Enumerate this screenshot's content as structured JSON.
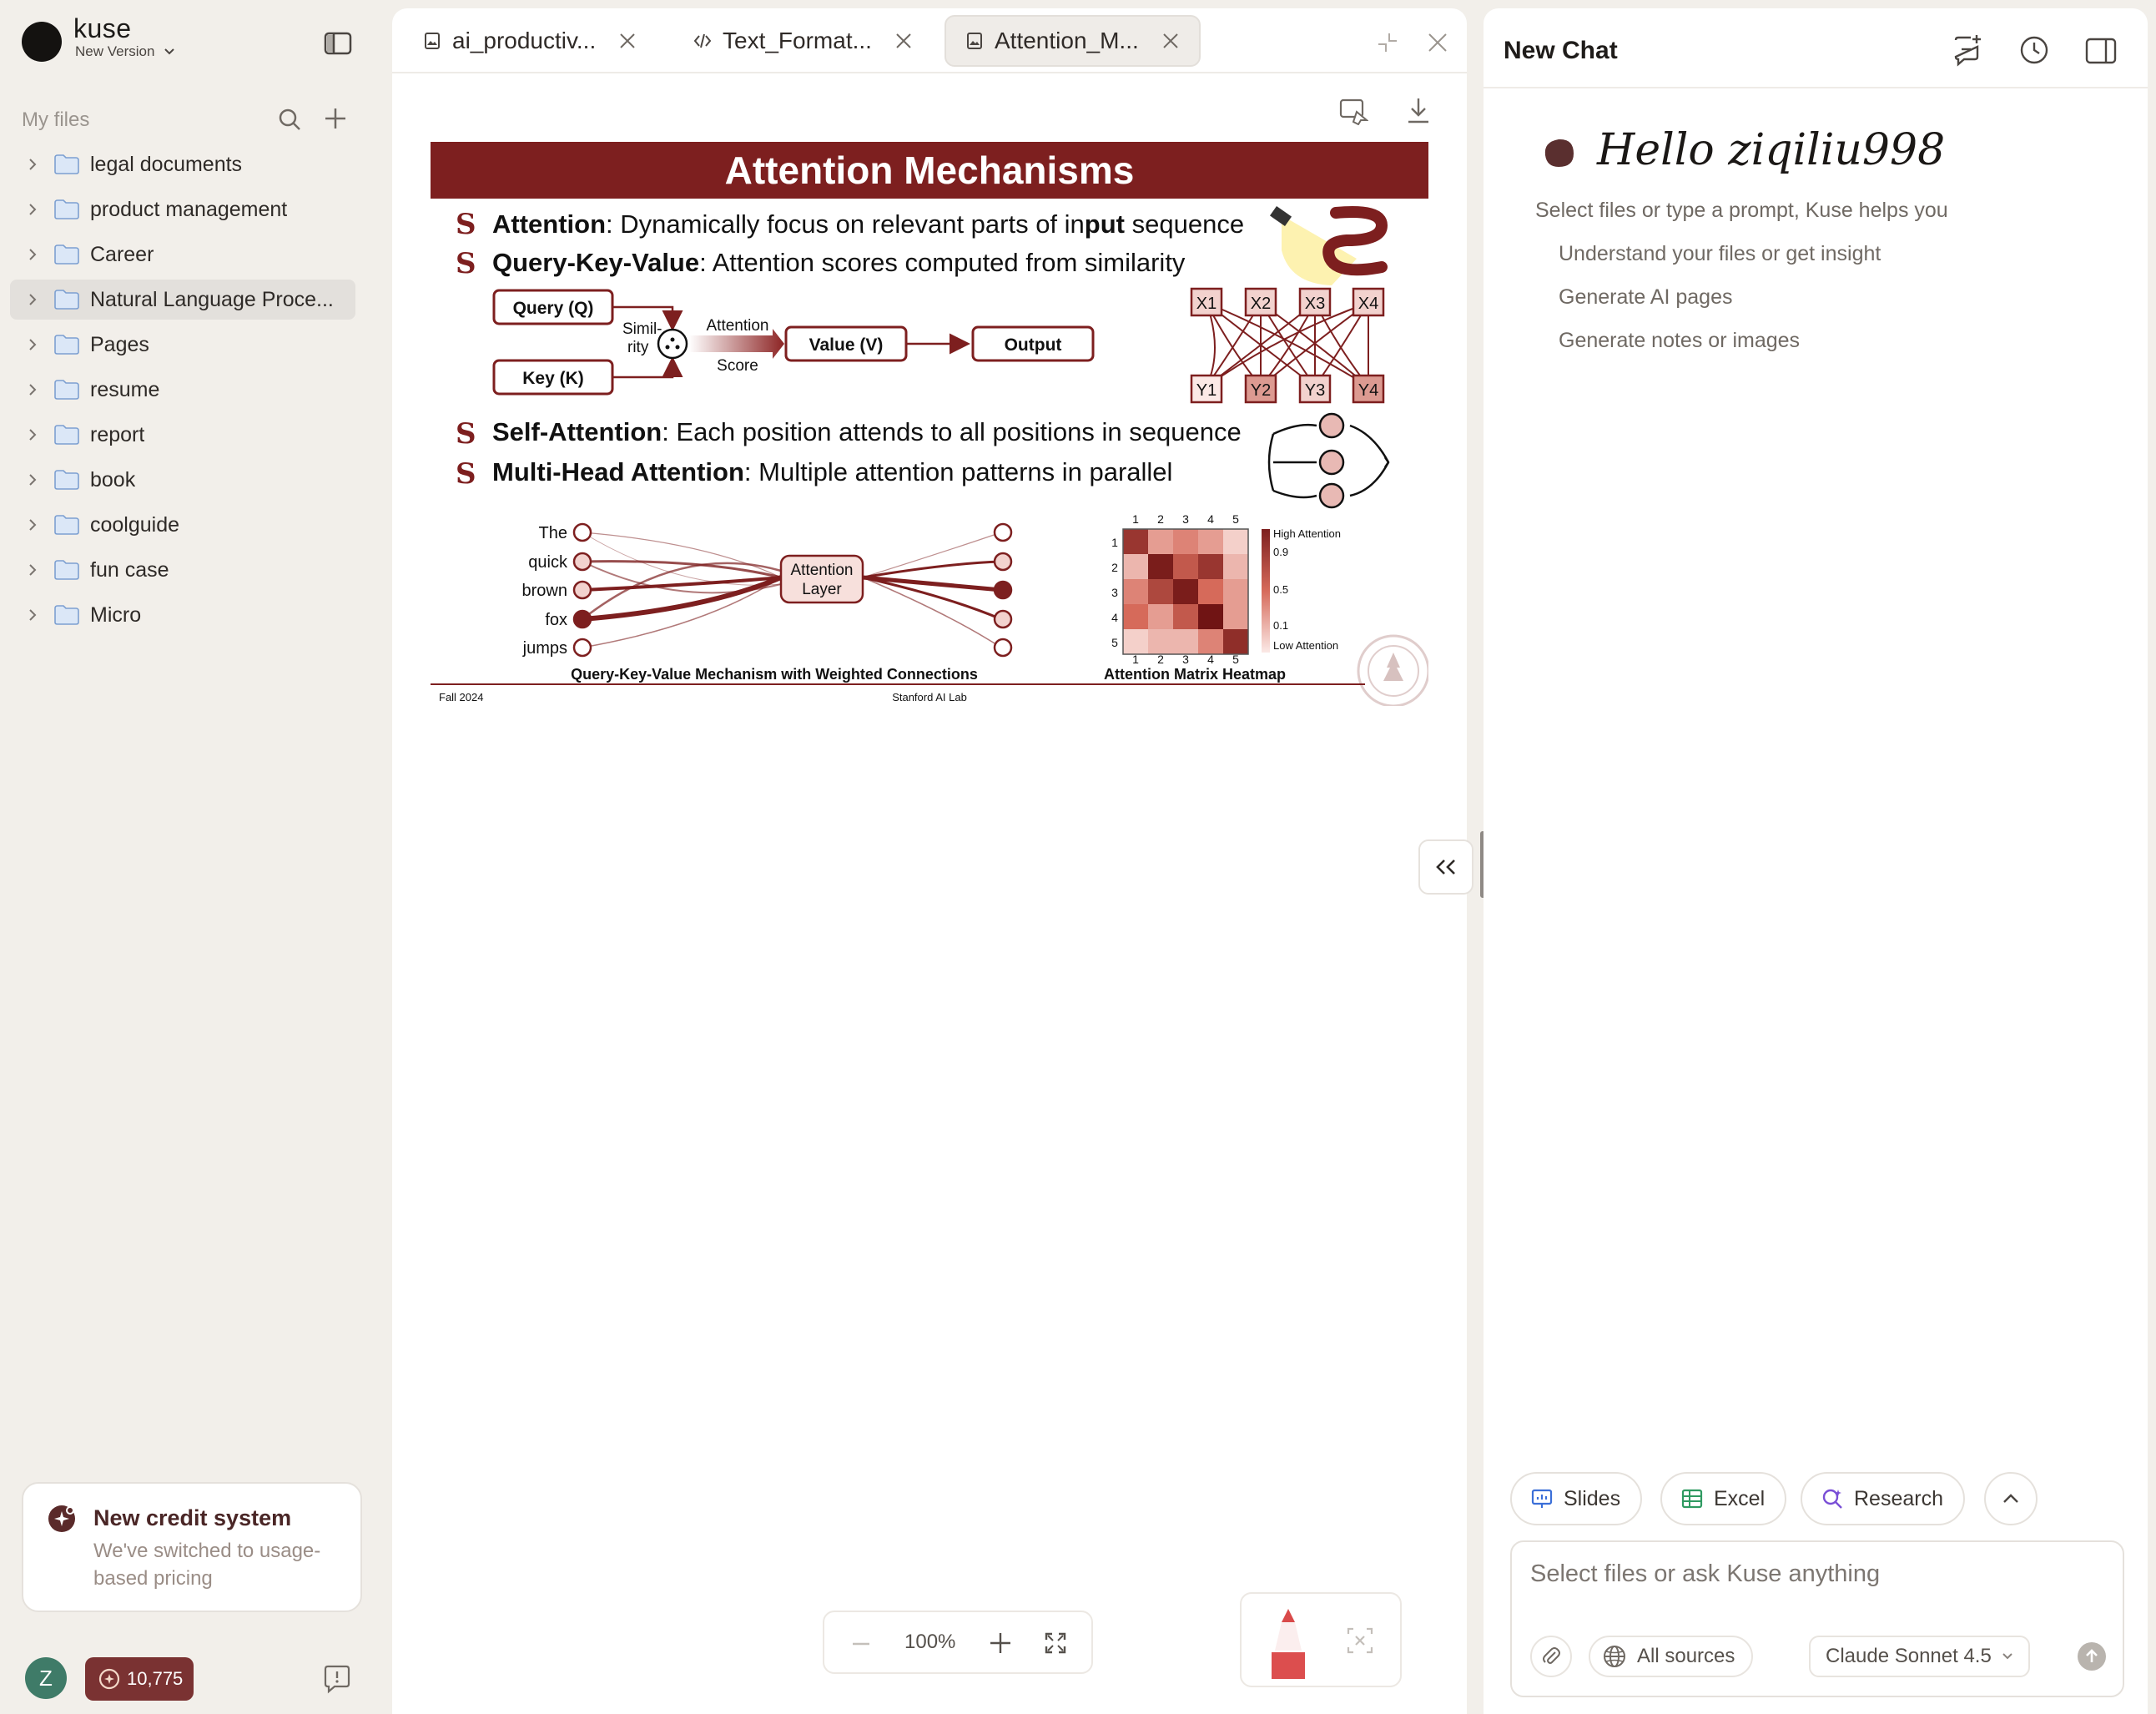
{
  "sidebar": {
    "brand": "kuse",
    "version_label": "New Version",
    "section_title": "My files",
    "folders": [
      {
        "name": "legal documents"
      },
      {
        "name": "product management"
      },
      {
        "name": "Career"
      },
      {
        "name": "Natural Language Proce...",
        "active": true
      },
      {
        "name": "Pages"
      },
      {
        "name": "resume"
      },
      {
        "name": "report"
      },
      {
        "name": "book"
      },
      {
        "name": "coolguide"
      },
      {
        "name": "fun case"
      },
      {
        "name": "Micro"
      }
    ],
    "credit_card": {
      "title": "New credit system",
      "subtitle": "We've switched to usage-based pricing"
    },
    "avatar_letter": "Z",
    "credits": "10,775"
  },
  "tabs": [
    {
      "name": "ai_productiv...",
      "icon": "image-file-icon"
    },
    {
      "name": "Text_Format...",
      "icon": "code-file-icon"
    },
    {
      "name": "Attention_M...",
      "icon": "image-file-icon",
      "active": true
    }
  ],
  "slide": {
    "title": "Attention Mechanisms",
    "bullets": [
      {
        "bold": "Attention",
        "text": ": Dynamically focus on relevant parts of in",
        "bold2": "put",
        "text2": " sequence"
      },
      {
        "bold": "Query-Key-Value",
        "text": ": Attention scores computed from similarity"
      },
      {
        "bold": "Self-Attention",
        "text": ": Each position attends to all positions in sequence"
      },
      {
        "bold": "Multi-Head Attention",
        "text": ": Multiple attention patterns in parallel"
      }
    ],
    "qkv": {
      "query": "Query (Q)",
      "key": "Key (K)",
      "similarity_1": "Simil-",
      "similarity_2": "rity",
      "attention_1": "Attention",
      "attention_2": "Score",
      "value": "Value (V)",
      "output": "Output"
    },
    "x_nodes": [
      "X1",
      "X2",
      "X3",
      "X4"
    ],
    "y_nodes": [
      "Y1",
      "Y2",
      "Y3",
      "Y4"
    ],
    "words": [
      "The",
      "quick",
      "brown",
      "fox",
      "jumps"
    ],
    "attention_layer_1": "Attention",
    "attention_layer_2": "Layer",
    "network_caption": "Query-Key-Value Mechanism with Weighted Connections",
    "heatmap": {
      "caption": "Attention Matrix Heatmap",
      "axis_ticks": [
        "1",
        "2",
        "3",
        "4",
        "5"
      ],
      "legend_high": "High Attention",
      "legend_low": "Low Attention",
      "legend_ticks": [
        "0.9",
        "0.5",
        "0.1"
      ],
      "matrix": [
        [
          0.8,
          0.3,
          0.4,
          0.3,
          0.1
        ],
        [
          0.2,
          0.95,
          0.6,
          0.8,
          0.2
        ],
        [
          0.4,
          0.7,
          0.95,
          0.5,
          0.3
        ],
        [
          0.5,
          0.3,
          0.6,
          1.0,
          0.3
        ],
        [
          0.1,
          0.2,
          0.2,
          0.4,
          0.85
        ]
      ]
    },
    "footer_left": "Fall 2024",
    "footer_center": "Stanford AI Lab",
    "colors": {
      "brand_red": "#7d1f1f",
      "light_red": "#e8b9b4"
    }
  },
  "zoom": "100%",
  "chat": {
    "title": "New Chat",
    "greeting": "Hello ziqiliu998",
    "hint": "Select files or type a prompt, Kuse helps you",
    "suggestions": [
      "Understand your files or get insight",
      "Generate AI pages",
      "Generate notes or images"
    ],
    "chips": [
      "Slides",
      "Excel",
      "Research"
    ],
    "input_placeholder": "Select files or ask Kuse anything",
    "sources_label": "All sources",
    "model_label": "Claude Sonnet 4.5"
  }
}
